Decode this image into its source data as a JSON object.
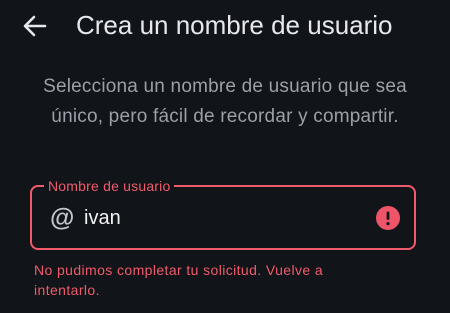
{
  "header": {
    "title": "Crea un nombre de usuario",
    "back_icon": "arrow-left-icon"
  },
  "description": {
    "line1": "Selecciona un nombre de usuario que sea",
    "line2": "único, pero fácil de recordar y compartir."
  },
  "username_field": {
    "label": "Nombre de usuario",
    "prefix_icon": "at-sign-icon",
    "prefix_symbol": "@",
    "value": "ivan",
    "trailing_icon": "error-icon",
    "state": "error"
  },
  "error_message": {
    "line1": "No pudimos completar tu solicitud. Vuelve a",
    "line2": "intentarlo."
  },
  "colors": {
    "background": "#111418",
    "error": "#f05b6c",
    "text_primary": "#e6e8ed",
    "text_secondary": "#9aa0a8"
  }
}
